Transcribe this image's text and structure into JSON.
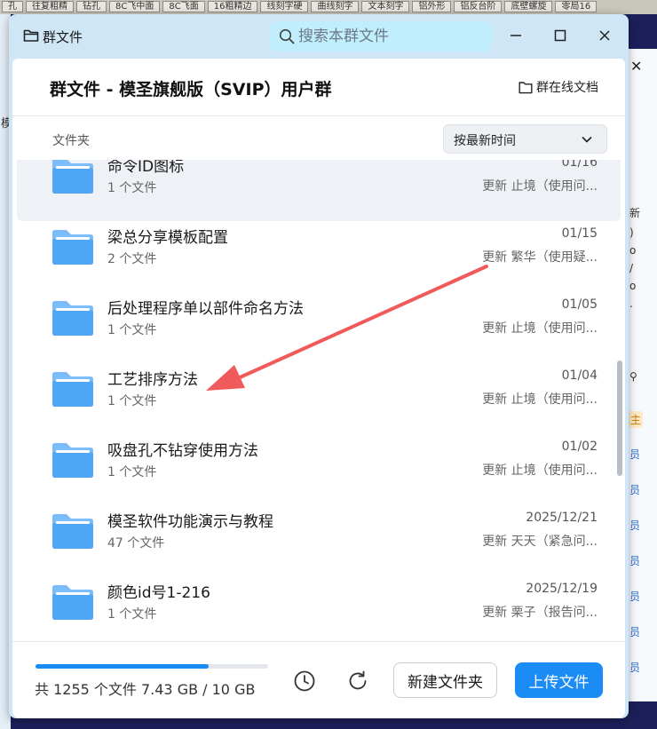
{
  "background": {
    "tabs": [
      "孔",
      "往复粗精",
      "钻孔",
      "8C飞中面",
      "8C飞面",
      "16粗精边",
      "线刻字硬",
      "曲线刻字",
      "文本刻字",
      "铝外形",
      "铝反台阶",
      "底壁螺旋",
      "零局16"
    ],
    "left_glyph": "模",
    "right_owner_badge": "主",
    "right_role_label": "员",
    "right_glyphs": [
      "新",
      ")",
      "o",
      "/",
      "o",
      "."
    ]
  },
  "window": {
    "title": "群文件",
    "search_placeholder": "搜索本群文件"
  },
  "header": {
    "group_title": "群文件 - 模圣旗舰版（SVIP）用户群",
    "online_docs_label": "群在线文档"
  },
  "list_header": {
    "label": "文件夹",
    "sort_selected": "按最新时间"
  },
  "folders": [
    {
      "name": "命令ID图标",
      "count": "1 个文件",
      "date": "01/16",
      "updater": "更新 止境（使用问..."
    },
    {
      "name": "梁总分享模板配置",
      "count": "2 个文件",
      "date": "01/15",
      "updater": "更新 繁华（使用疑..."
    },
    {
      "name": "后处理程序单以部件命名方法",
      "count": "1 个文件",
      "date": "01/05",
      "updater": "更新 止境（使用问..."
    },
    {
      "name": "工艺排序方法",
      "count": "1 个文件",
      "date": "01/04",
      "updater": "更新 止境（使用问..."
    },
    {
      "name": "吸盘孔不钻穿使用方法",
      "count": "1 个文件",
      "date": "01/02",
      "updater": "更新 止境（使用问..."
    },
    {
      "name": "模圣软件功能演示与教程",
      "count": "47 个文件",
      "date": "2025/12/21",
      "updater": "更新 天天（紧急问..."
    },
    {
      "name": "颜色id号1-216",
      "count": "1 个文件",
      "date": "2025/12/19",
      "updater": "更新 栗子（报告问..."
    }
  ],
  "footer": {
    "storage_text": "共 1255 个文件  7.43 GB / 10 GB",
    "storage_used_fraction": 0.743,
    "new_folder_label": "新建文件夹",
    "upload_label": "上传文件"
  },
  "colors": {
    "accent": "#1b8cf5",
    "folder": "#4fa6f7",
    "annotation_arrow": "#f05a5a"
  }
}
